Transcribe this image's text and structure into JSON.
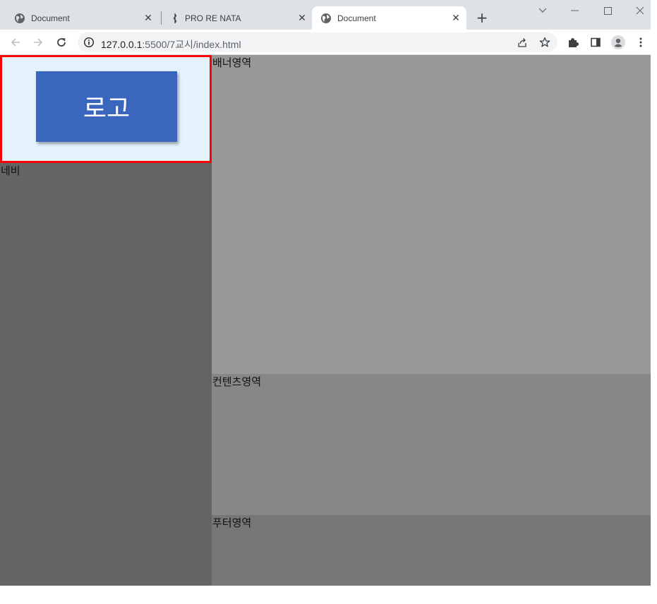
{
  "tabs": [
    {
      "title": "Document",
      "icon": "globe-icon",
      "active": false
    },
    {
      "title": "PRO RE NATA",
      "icon": "rod-of-asclepius-icon",
      "active": false
    },
    {
      "title": "Document",
      "icon": "globe-icon",
      "active": true
    }
  ],
  "toolbar": {
    "url_host": "127.0.0.1",
    "url_path": ":5500/7교시/index.html"
  },
  "page": {
    "logo_text": "로고",
    "nav_label": "네비",
    "banner_label": "배너영역",
    "contents_label": "컨텐츠영역",
    "footer_label": "푸터영역"
  },
  "colors": {
    "logo_bg": "#e3f2fd",
    "logo_border": "#ff0000",
    "logo_box": "#3a66be",
    "nav_bg": "#646464",
    "banner_bg": "#989898",
    "contents_bg": "#878787",
    "footer_bg": "#777777"
  }
}
